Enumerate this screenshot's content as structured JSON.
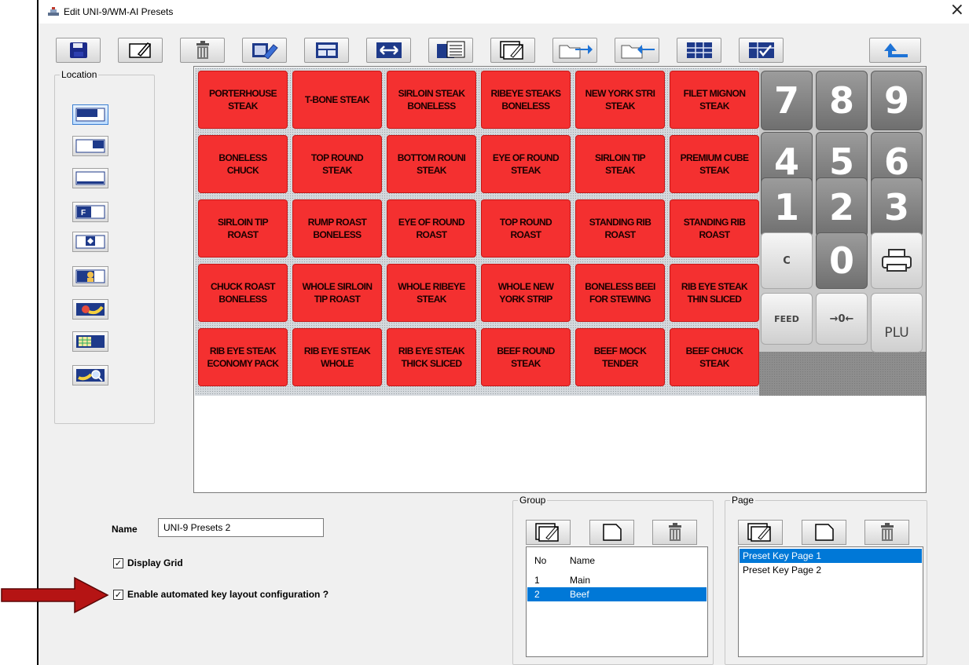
{
  "window": {
    "title": "Edit UNI-9/WM-AI Presets",
    "close_icon": "close-icon"
  },
  "toolbar": {
    "buttons": [
      {
        "name": "save-button",
        "icon": "floppy-disk-icon"
      },
      {
        "name": "edit-key-button",
        "icon": "edit-pencil-icon"
      },
      {
        "name": "delete-button",
        "icon": "trash-can-icon"
      },
      {
        "name": "clear-key-button",
        "icon": "eraser-icon"
      },
      {
        "name": "key-layout-button",
        "icon": "layout-icon"
      },
      {
        "name": "swap-keys-button",
        "icon": "swap-arrows-icon"
      },
      {
        "name": "list-view-button",
        "icon": "list-icon"
      },
      {
        "name": "edit-group-button",
        "icon": "edit-window-icon"
      },
      {
        "name": "import-button",
        "icon": "folder-import-icon"
      },
      {
        "name": "export-button",
        "icon": "folder-export-icon"
      },
      {
        "name": "grid-view-button",
        "icon": "grid-icon"
      },
      {
        "name": "check-grid-button",
        "icon": "check-grid-icon"
      },
      {
        "name": "back-button",
        "icon": "arrow-up-left-icon"
      }
    ]
  },
  "location": {
    "label": "Location",
    "buttons": [
      {
        "name": "location-top-button",
        "icon": "layout-top-icon",
        "selected": true
      },
      {
        "name": "location-top-right-button",
        "icon": "layout-right-icon",
        "selected": false
      },
      {
        "name": "location-bottom-button",
        "icon": "layout-bottom-icon",
        "selected": false
      },
      {
        "name": "location-f-button",
        "icon": "layout-f-icon",
        "selected": false
      },
      {
        "name": "location-diamond-button",
        "icon": "diamond-icon",
        "selected": false
      },
      {
        "name": "location-person-button",
        "icon": "person-icon",
        "selected": false
      },
      {
        "name": "location-fruit-button",
        "icon": "fruit-icon",
        "selected": false
      },
      {
        "name": "location-table-button",
        "icon": "table-icon",
        "selected": false
      },
      {
        "name": "location-search-button",
        "icon": "magnifier-icon",
        "selected": false
      }
    ]
  },
  "preset_keys": [
    [
      "PORTERHOUSE\nSTEAK",
      "T-BONE STEAK",
      "SIRLOIN STEAK\nBONELESS",
      "RIBEYE STEAKS\nBONELESS",
      "NEW YORK STRI\nSTEAK",
      "FILET MIGNON\nSTEAK"
    ],
    [
      "BONELESS\nCHUCK",
      "TOP ROUND\nSTEAK",
      "BOTTOM ROUNI\nSTEAK",
      "EYE OF ROUND\nSTEAK",
      "SIRLOIN TIP\nSTEAK",
      "PREMIUM CUBE\nSTEAK"
    ],
    [
      "SIRLOIN TIP\nROAST",
      "RUMP ROAST\nBONELESS",
      "EYE OF ROUND\nROAST",
      "TOP ROUND\nROAST",
      "STANDING RIB\nROAST",
      "STANDING RIB\nROAST"
    ],
    [
      "CHUCK ROAST\nBONELESS",
      "WHOLE SIRLOIN\nTIP ROAST",
      "WHOLE RIBEYE\nSTEAK",
      "WHOLE NEW\nYORK STRIP",
      "BONELESS BEEI\nFOR STEWING",
      "RIB EYE STEAK\nTHIN SLICED"
    ],
    [
      "RIB EYE STEAK\nECONOMY PACK",
      "RIB EYE STEAK\nWHOLE",
      "RIB EYE STEAK\nTHICK SLICED",
      "BEEF ROUND\nSTEAK",
      "BEEF MOCK\nTENDER",
      "BEEF CHUCK\nSTEAK"
    ]
  ],
  "keypad": {
    "digits": [
      [
        "7",
        "8",
        "9"
      ],
      [
        "4",
        "5",
        "6"
      ],
      [
        "1",
        "2",
        "3"
      ]
    ],
    "clear": "C",
    "zero": "0",
    "feed": "FEED",
    "zero_arrows": "→0←",
    "plu": "PLU",
    "print_icon": "printer-icon"
  },
  "form": {
    "name_label": "Name",
    "name_value": "UNI-9 Presets 2",
    "display_grid_label": "Display Grid",
    "display_grid_checked": true,
    "auto_layout_label": "Enable automated key layout configuration ?",
    "auto_layout_checked": true
  },
  "group": {
    "label": "Group",
    "columns": [
      "No",
      "Name"
    ],
    "rows": [
      {
        "no": "1",
        "name": "Main",
        "selected": false
      },
      {
        "no": "2",
        "name": "Beef",
        "selected": true
      }
    ]
  },
  "page": {
    "label": "Page",
    "rows": [
      {
        "name": "Preset Key Page 1",
        "selected": true
      },
      {
        "name": "Preset Key Page 2",
        "selected": false
      }
    ]
  },
  "colors": {
    "preset_key": "#f43030",
    "selection": "#0078d7",
    "annotation_arrow": "#b51414"
  }
}
